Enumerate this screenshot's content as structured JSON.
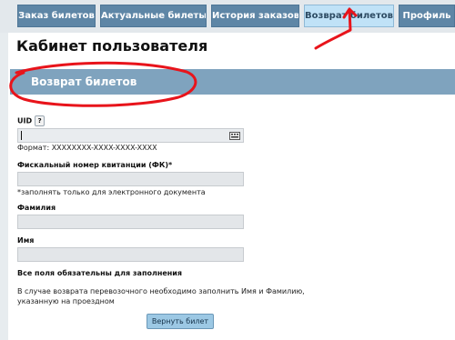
{
  "tabs": [
    {
      "label": "Заказ билетов"
    },
    {
      "label": "Актуальные билеты"
    },
    {
      "label": "История заказов"
    },
    {
      "label": "Возврат билетов",
      "active": true
    },
    {
      "label": "Профиль"
    }
  ],
  "page": {
    "title": "Кабинет пользователя",
    "section_title": "Возврат билетов"
  },
  "form": {
    "uid_label": "UID",
    "help_glyph": "?",
    "uid_format": "Формат: XXXXXXXX-XXXX-XXXX-XXXX",
    "uid_value": "",
    "fk_label": "Фискальный номер квитанции (ФК)*",
    "fk_value": "",
    "fk_note": "*заполнять только для электронного документа",
    "lastname_label": "Фамилия",
    "lastname_value": "",
    "firstname_label": "Имя",
    "firstname_value": "",
    "required_note": "Все поля обязательны для заполнения",
    "info_line1": "В случае возврата перевозочного необходимо заполнить Имя и Фамилию,",
    "info_line2": "указанную на проездном",
    "submit_label": "Вернуть билет"
  },
  "colors": {
    "tab_bg": "#5e86a6",
    "tab_active_bg": "#c0e2f7",
    "section_bar": "#7fa3be",
    "annotation_red": "#e8141b"
  },
  "icons": [
    "keyboard-icon",
    "help-icon",
    "annotation-arrow",
    "annotation-circle"
  ]
}
